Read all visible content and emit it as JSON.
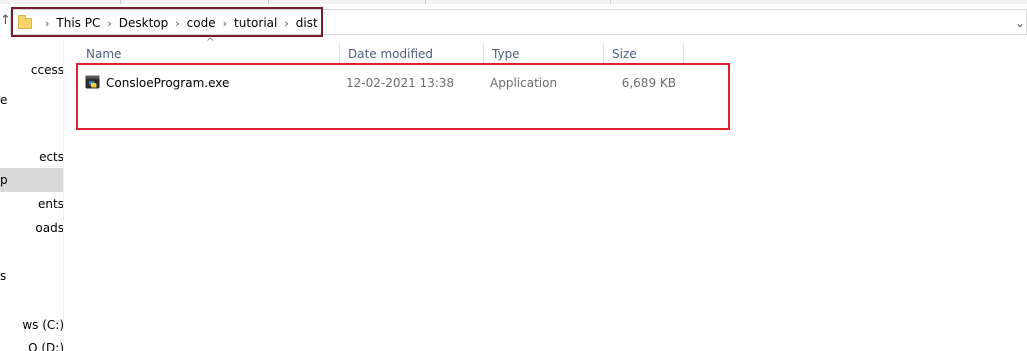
{
  "window": {
    "address_bar": {
      "breadcrumb": [
        "This PC",
        "Desktop",
        "code",
        "tutorial",
        "dist"
      ],
      "separator": "›",
      "dropdown_glyph": "⌄"
    },
    "up_glyph": "↑",
    "highlight_colors": {
      "address": "#7b1a2c",
      "file": "#e0202d"
    }
  },
  "nav_pane": {
    "items": [
      {
        "label": "ccess"
      },
      {
        "label": "e"
      },
      {
        "label": "ects"
      },
      {
        "label": "p",
        "selected": true
      },
      {
        "label": "ents"
      },
      {
        "label": "oads"
      },
      {
        "label": "s"
      },
      {
        "label": "ws (C:)"
      },
      {
        "label": "O (D:)"
      }
    ]
  },
  "file_list": {
    "sort_indicator": "^",
    "columns": {
      "name": "Name",
      "date": "Date modified",
      "type": "Type",
      "size": "Size"
    },
    "rows": [
      {
        "name": "ConsloeProgram.exe",
        "date": "12-02-2021 13:38",
        "type": "Application",
        "size": "6,689 KB",
        "icon": "python-exe-icon"
      }
    ]
  }
}
